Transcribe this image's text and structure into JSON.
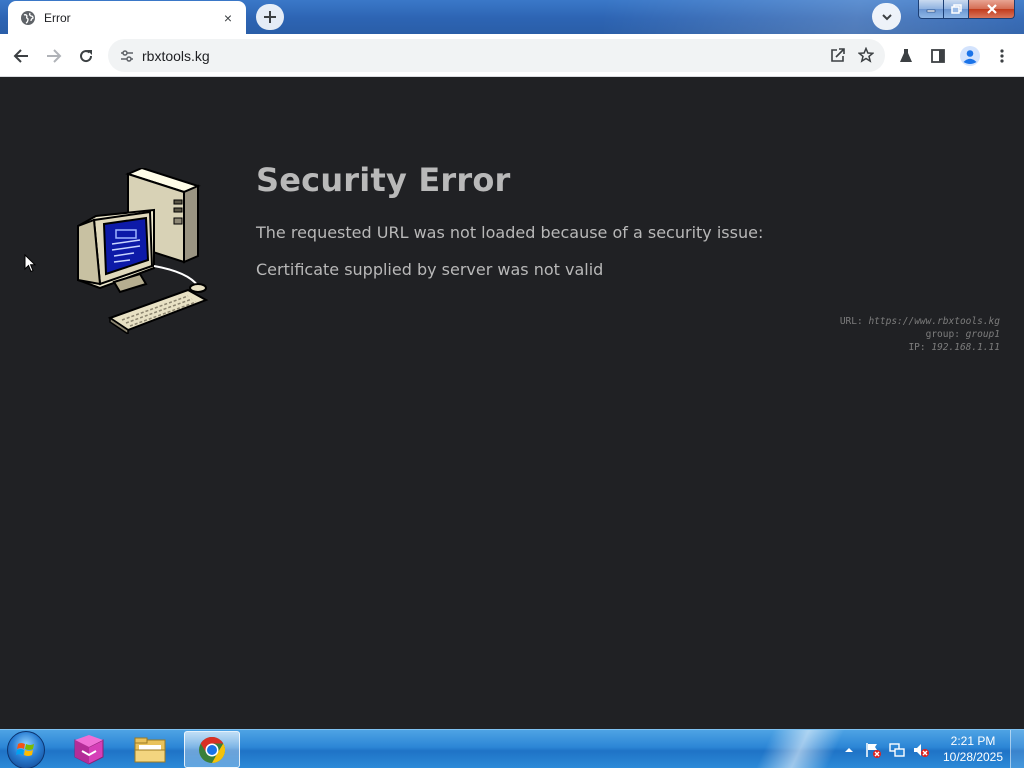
{
  "browser": {
    "tab": {
      "title": "Error",
      "favicon": "globe-icon",
      "close": "×"
    },
    "new_tab_icon": "plus-icon",
    "tab_search_icon": "chevron-down-icon",
    "window_controls": [
      "minimize",
      "maximize",
      "close"
    ],
    "toolbar": {
      "back_icon": "arrow-left-icon",
      "forward_icon": "arrow-right-icon",
      "reload_icon": "reload-icon",
      "site_info_icon": "tune-icon",
      "url": "rbxtools.kg",
      "share_icon": "share-icon",
      "bookmark_icon": "star-icon",
      "extensions_icon": "flask-icon",
      "side_panel_icon": "side-panel-icon",
      "profile_icon": "person-icon",
      "menu_icon": "kebab-menu-icon"
    }
  },
  "error_page": {
    "illustration": "retro-computer-icon",
    "title": "Security Error",
    "message": "The requested URL was not loaded because of a security issue:",
    "reason": "Certificate supplied by server was not valid",
    "details": {
      "url_label": "URL:",
      "url_value": "https://www.rbxtools.kg",
      "group_label": "group:",
      "group_value": "group1",
      "ip_label": "IP:",
      "ip_value": "192.168.1.11"
    }
  },
  "taskbar": {
    "start_icon": "windows-start-orb",
    "apps": [
      {
        "name": "app-launcher-icon",
        "active": false
      },
      {
        "name": "file-explorer-icon",
        "active": false
      },
      {
        "name": "chrome-icon",
        "active": true
      }
    ],
    "tray": [
      "show-hidden-icons",
      "action-center-flag-icon",
      "network-icon",
      "volume-muted-icon"
    ],
    "time": "2:21 PM",
    "date": "10/28/2025"
  },
  "colors": {
    "page_bg": "#202124",
    "title_text": "#b9b9b9",
    "body_text": "#b8b8b8",
    "details_text": "#7d7d7d",
    "titlebar": "#2d64b3",
    "taskbar": "#2c86d6"
  }
}
